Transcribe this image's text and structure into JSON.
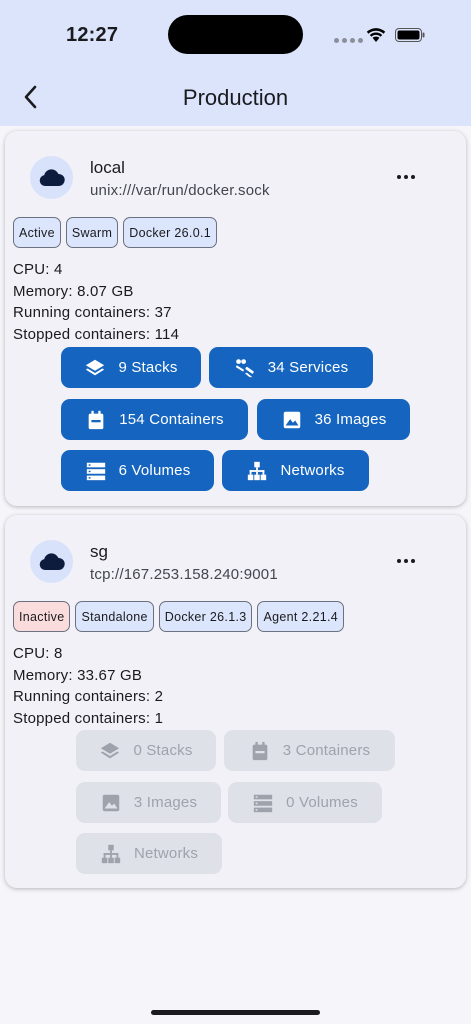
{
  "status_bar": {
    "time": "12:27"
  },
  "header": {
    "title": "Production"
  },
  "colors": {
    "accent": "#1565c0",
    "header_bg": "#dbe4fb",
    "inactive_chip": "#fbdcdc",
    "chip": "#dbe5fb"
  },
  "hosts": [
    {
      "name": "local",
      "url": "unix:///var/run/docker.sock",
      "badges": [
        "Active",
        "Swarm",
        "Docker 26.0.1"
      ],
      "cpu_label": "CPU:  4",
      "memory_label": "Memory:  8.07 GB",
      "running_label": "Running containers:  37",
      "stopped_label": "Stopped containers:  114",
      "buttons": {
        "stacks": "9 Stacks",
        "services": "34 Services",
        "containers": "154 Containers",
        "images": "36 Images",
        "volumes": "6 Volumes",
        "networks": "Networks"
      }
    },
    {
      "name": "sg",
      "url": "tcp://167.253.158.240:9001",
      "badges": [
        "Inactive",
        "Standalone",
        "Docker 26.1.3",
        "Agent 2.21.4"
      ],
      "cpu_label": "CPU:  8",
      "memory_label": "Memory:  33.67 GB",
      "running_label": "Running containers:  2",
      "stopped_label": "Stopped containers:  1",
      "buttons": {
        "stacks": "0 Stacks",
        "containers": "3 Containers",
        "images": "3 Images",
        "volumes": "0 Volumes",
        "networks": "Networks"
      }
    }
  ]
}
